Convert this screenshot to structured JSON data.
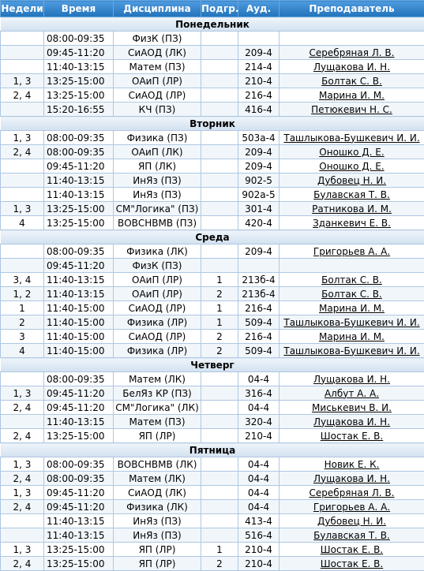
{
  "headers": [
    "Недели",
    "Время",
    "Дисциплина",
    "Подгр.",
    "Ауд.",
    "Преподаватель"
  ],
  "days": [
    {
      "name": "Понедельник",
      "rows": [
        {
          "weeks": "",
          "time": "08:00-09:35",
          "subject": "ФизК (ПЗ)",
          "subgroup": "",
          "room": "",
          "teacher": ""
        },
        {
          "weeks": "",
          "time": "09:45-11:20",
          "subject": "СиАОД (ЛК)",
          "subgroup": "",
          "room": "209-4",
          "teacher": "Серебряная Л. В."
        },
        {
          "weeks": "",
          "time": "11:40-13:15",
          "subject": "Матем (ПЗ)",
          "subgroup": "",
          "room": "214-4",
          "teacher": "Лущакова И. Н."
        },
        {
          "weeks": "1, 3",
          "time": "13:25-15:00",
          "subject": "ОАиП (ЛР)",
          "subgroup": "",
          "room": "210-4",
          "teacher": "Болтак С. В."
        },
        {
          "weeks": "2, 4",
          "time": "13:25-15:00",
          "subject": "СиАОД (ЛР)",
          "subgroup": "",
          "room": "216-4",
          "teacher": "Марина И. М."
        },
        {
          "weeks": "",
          "time": "15:20-16:55",
          "subject": "КЧ (ПЗ)",
          "subgroup": "",
          "room": "416-4",
          "teacher": "Петюкевич Н. С."
        }
      ]
    },
    {
      "name": "Вторник",
      "rows": [
        {
          "weeks": "1, 3",
          "time": "08:00-09:35",
          "subject": "Физика (ПЗ)",
          "subgroup": "",
          "room": "503а-4",
          "teacher": "Ташлыкова-Бушкевич И. И."
        },
        {
          "weeks": "2, 4",
          "time": "08:00-09:35",
          "subject": "ОАиП (ЛК)",
          "subgroup": "",
          "room": "209-4",
          "teacher": "Оношко Д. Е."
        },
        {
          "weeks": "",
          "time": "09:45-11:20",
          "subject": "ЯП (ЛК)",
          "subgroup": "",
          "room": "209-4",
          "teacher": "Оношко Д. Е."
        },
        {
          "weeks": "",
          "time": "11:40-13:15",
          "subject": "ИнЯз (ПЗ)",
          "subgroup": "",
          "room": "902-5",
          "teacher": "Дубовец Н. И."
        },
        {
          "weeks": "",
          "time": "11:40-13:15",
          "subject": "ИнЯз (ПЗ)",
          "subgroup": "",
          "room": "902а-5",
          "teacher": "Булавская Т. В."
        },
        {
          "weeks": "1, 3",
          "time": "13:25-15:00",
          "subject": "СМ\"Логика\" (ПЗ)",
          "subgroup": "",
          "room": "301-4",
          "teacher": "Ратникова И. М."
        },
        {
          "weeks": "4",
          "time": "13:25-15:00",
          "subject": "ВОВСНВМВ (ПЗ)",
          "subgroup": "",
          "room": "420-4",
          "teacher": "Зданкевич Е. В."
        }
      ]
    },
    {
      "name": "Среда",
      "rows": [
        {
          "weeks": "",
          "time": "08:00-09:35",
          "subject": "Физика (ЛК)",
          "subgroup": "",
          "room": "209-4",
          "teacher": "Григорьев А. А."
        },
        {
          "weeks": "",
          "time": "09:45-11:20",
          "subject": "ФизК (ПЗ)",
          "subgroup": "",
          "room": "",
          "teacher": ""
        },
        {
          "weeks": "3, 4",
          "time": "11:40-13:15",
          "subject": "ОАиП (ЛР)",
          "subgroup": "1",
          "room": "213б-4",
          "teacher": "Болтак С. В."
        },
        {
          "weeks": "1, 2",
          "time": "11:40-13:15",
          "subject": "ОАиП (ЛР)",
          "subgroup": "2",
          "room": "213б-4",
          "teacher": "Болтак С. В."
        },
        {
          "weeks": "1",
          "time": "11:40-15:00",
          "subject": "СиАОД (ЛР)",
          "subgroup": "1",
          "room": "216-4",
          "teacher": "Марина И. М."
        },
        {
          "weeks": "2",
          "time": "11:40-15:00",
          "subject": "Физика (ЛР)",
          "subgroup": "1",
          "room": "509-4",
          "teacher": "Ташлыкова-Бушкевич И. И."
        },
        {
          "weeks": "3",
          "time": "11:40-15:00",
          "subject": "СиАОД (ЛР)",
          "subgroup": "2",
          "room": "216-4",
          "teacher": "Марина И. М."
        },
        {
          "weeks": "4",
          "time": "11:40-15:00",
          "subject": "Физика (ЛР)",
          "subgroup": "2",
          "room": "509-4",
          "teacher": "Ташлыкова-Бушкевич И. И."
        }
      ]
    },
    {
      "name": "Четверг",
      "rows": [
        {
          "weeks": "",
          "time": "08:00-09:35",
          "subject": "Матем (ЛК)",
          "subgroup": "",
          "room": "04-4",
          "teacher": "Лущакова И. Н."
        },
        {
          "weeks": "1, 3",
          "time": "09:45-11:20",
          "subject": "БелЯз КР (ПЗ)",
          "subgroup": "",
          "room": "316-4",
          "teacher": "Албут А. А."
        },
        {
          "weeks": "2, 4",
          "time": "09:45-11:20",
          "subject": "СМ\"Логика\" (ЛК)",
          "subgroup": "",
          "room": "04-4",
          "teacher": "Миськевич В. И."
        },
        {
          "weeks": "",
          "time": "11:40-13:15",
          "subject": "Матем (ПЗ)",
          "subgroup": "",
          "room": "320-4",
          "teacher": "Лущакова И. Н."
        },
        {
          "weeks": "2, 4",
          "time": "13:25-15:00",
          "subject": "ЯП (ЛР)",
          "subgroup": "",
          "room": "210-4",
          "teacher": "Шостак Е. В."
        }
      ]
    },
    {
      "name": "Пятница",
      "rows": [
        {
          "weeks": "1, 3",
          "time": "08:00-09:35",
          "subject": "ВОВСНВМВ (ЛК)",
          "subgroup": "",
          "room": "04-4",
          "teacher": "Новик Е. К."
        },
        {
          "weeks": "2, 4",
          "time": "08:00-09:35",
          "subject": "Матем (ЛК)",
          "subgroup": "",
          "room": "04-4",
          "teacher": "Лущакова И. Н."
        },
        {
          "weeks": "1, 3",
          "time": "09:45-11:20",
          "subject": "СиАОД (ЛК)",
          "subgroup": "",
          "room": "04-4",
          "teacher": "Серебряная Л. В."
        },
        {
          "weeks": "2, 4",
          "time": "09:45-11:20",
          "subject": "Физика (ЛК)",
          "subgroup": "",
          "room": "04-4",
          "teacher": "Григорьев А. А."
        },
        {
          "weeks": "",
          "time": "11:40-13:15",
          "subject": "ИнЯз (ПЗ)",
          "subgroup": "",
          "room": "413-4",
          "teacher": "Дубовец Н. И."
        },
        {
          "weeks": "",
          "time": "11:40-13:15",
          "subject": "ИнЯз (ПЗ)",
          "subgroup": "",
          "room": "516-4",
          "teacher": "Булавская Т. В."
        },
        {
          "weeks": "1, 3",
          "time": "13:25-15:00",
          "subject": "ЯП (ЛР)",
          "subgroup": "1",
          "room": "210-4",
          "teacher": "Шостак Е. В."
        },
        {
          "weeks": "2, 4",
          "time": "13:25-15:00",
          "subject": "ЯП (ЛР)",
          "subgroup": "2",
          "room": "210-4",
          "teacher": "Шостак Е. В."
        }
      ]
    }
  ]
}
